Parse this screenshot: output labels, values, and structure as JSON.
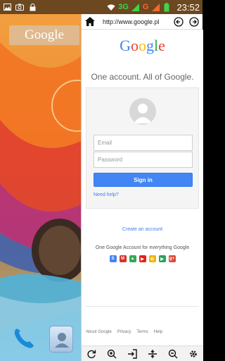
{
  "status_bar": {
    "net_3g": "3G",
    "net_g": "G",
    "time": "23:52"
  },
  "home": {
    "google_widget": "Google"
  },
  "browser": {
    "url": "http://www.google.pl",
    "logo_letters": [
      {
        "char": "G",
        "color": "#4285f4"
      },
      {
        "char": "o",
        "color": "#ea4335"
      },
      {
        "char": "o",
        "color": "#fbbc05"
      },
      {
        "char": "g",
        "color": "#4285f4"
      },
      {
        "char": "l",
        "color": "#34a853"
      },
      {
        "char": "e",
        "color": "#ea4335"
      }
    ],
    "tagline": "One account. All of Google.",
    "email_placeholder": "Email",
    "password_placeholder": "Password",
    "sign_in": "Sign in",
    "need_help": "Need help?",
    "create_account": "Create an account",
    "one_google": "One Google Account for everything Google",
    "products": [
      {
        "icon": "google-plus-icon",
        "label": "S",
        "color": "#4285f4"
      },
      {
        "icon": "gmail-icon",
        "label": "M",
        "color": "#d93025"
      },
      {
        "icon": "drive-icon",
        "label": "▲",
        "color": "#34a853"
      },
      {
        "icon": "youtube-icon",
        "label": "▶",
        "color": "#e62117"
      },
      {
        "icon": "photos-icon",
        "label": "✿",
        "color": "#f4b400"
      },
      {
        "icon": "play-icon",
        "label": "▶",
        "color": "#2aa35a"
      },
      {
        "icon": "google-plus-red-icon",
        "label": "g+",
        "color": "#dd4b39"
      }
    ],
    "footer": [
      "About Google",
      "Privacy",
      "Terms",
      "Help"
    ]
  }
}
